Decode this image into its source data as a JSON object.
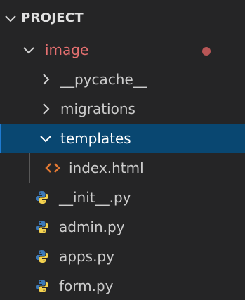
{
  "explorer": {
    "section_title": "PROJECT",
    "colors": {
      "background": "#252526",
      "selected_background": "#094771",
      "folder_modified_text": "#e57070",
      "modified_dot": "#b85656",
      "html_icon": "#e37933",
      "python_icon_blue": "#3d7ab8",
      "python_icon_yellow": "#f5d34f"
    },
    "tree": [
      {
        "label": "image",
        "type": "folder",
        "state": "expanded",
        "modified": true,
        "icon": "chevron-down-icon"
      },
      {
        "label": "__pycache__",
        "type": "folder",
        "state": "collapsed",
        "icon": "chevron-right-icon"
      },
      {
        "label": "migrations",
        "type": "folder",
        "state": "collapsed",
        "icon": "chevron-right-icon"
      },
      {
        "label": "templates",
        "type": "folder",
        "state": "expanded",
        "selected": true,
        "icon": "chevron-down-icon"
      },
      {
        "label": "index.html",
        "type": "file",
        "icon": "html-file-icon"
      },
      {
        "label": "__init__.py",
        "type": "file",
        "icon": "python-file-icon"
      },
      {
        "label": "admin.py",
        "type": "file",
        "icon": "python-file-icon"
      },
      {
        "label": "apps.py",
        "type": "file",
        "icon": "python-file-icon"
      },
      {
        "label": "form.py",
        "type": "file",
        "icon": "python-file-icon"
      }
    ]
  }
}
